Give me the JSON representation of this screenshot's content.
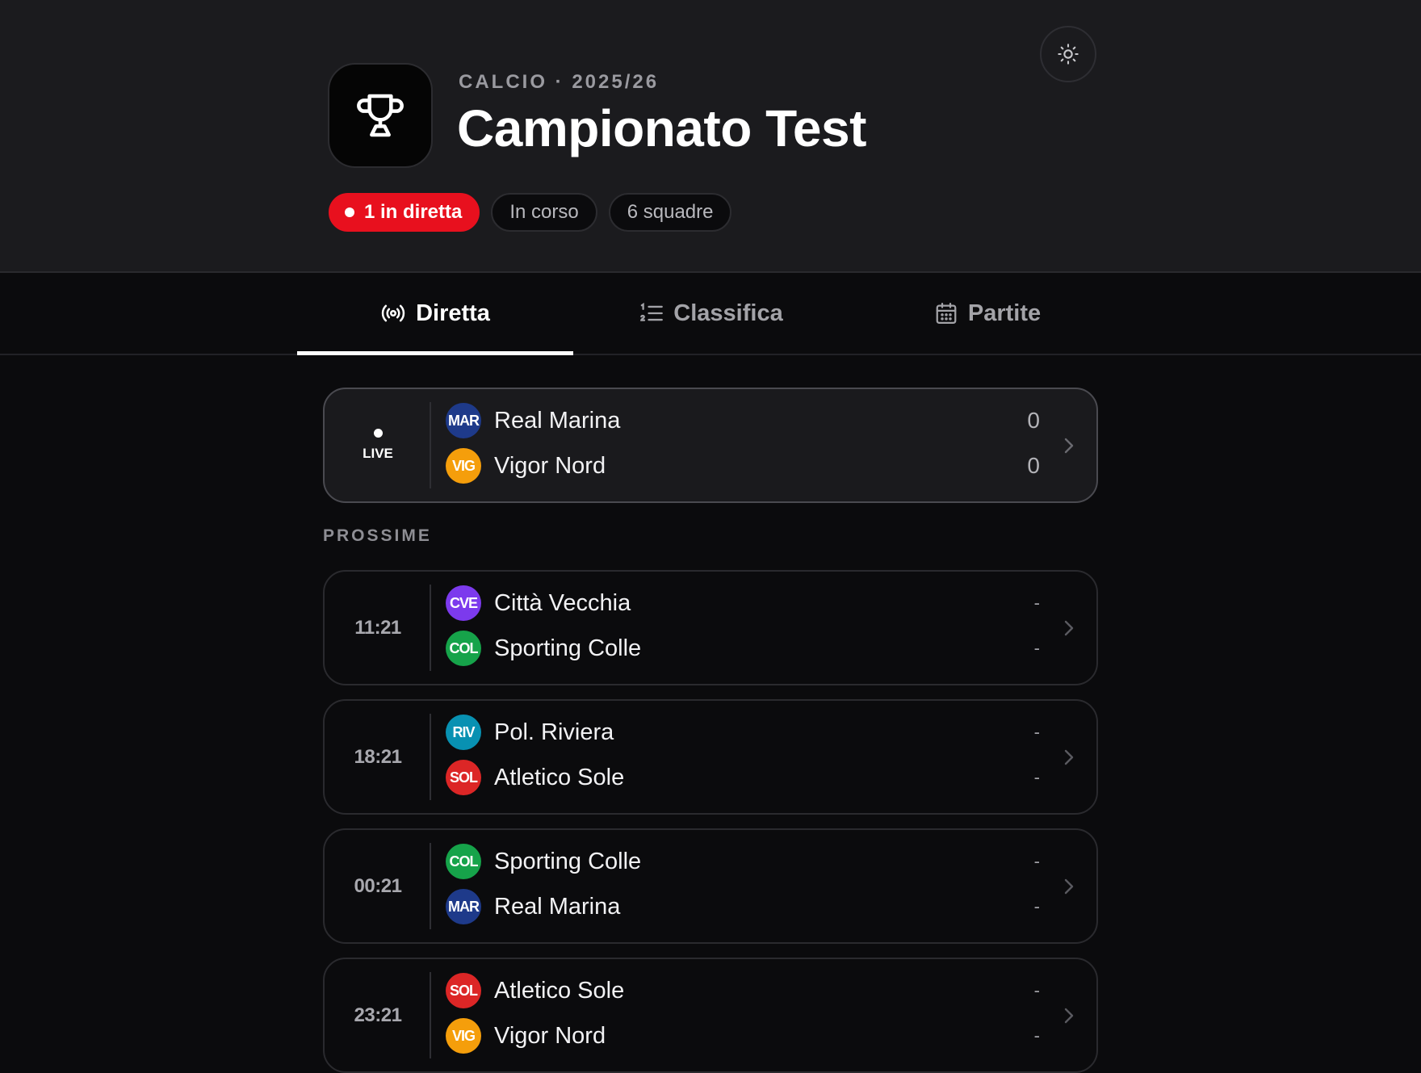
{
  "header": {
    "kicker": "CALCIO · 2025/26",
    "title": "Campionato Test",
    "chips": {
      "live": "1 in diretta",
      "status": "In corso",
      "teams": "6 squadre"
    }
  },
  "tabs": [
    {
      "label": "Diretta",
      "icon": "broadcast-icon",
      "active": true
    },
    {
      "label": "Classifica",
      "icon": "ranked-list-icon",
      "active": false
    },
    {
      "label": "Partite",
      "icon": "calendar-icon",
      "active": false
    }
  ],
  "live_match": {
    "label": "LIVE",
    "home": {
      "abbr": "MAR",
      "name": "Real Marina",
      "score": "0",
      "color": "#1e3a8a"
    },
    "away": {
      "abbr": "VIG",
      "name": "Vigor Nord",
      "score": "0",
      "color": "#f59e0b"
    }
  },
  "upcoming": {
    "label": "PROSSIME",
    "matches": [
      {
        "time": "11:21",
        "home": {
          "abbr": "CVE",
          "name": "Città Vecchia",
          "score": "-",
          "color": "#7c3aed"
        },
        "away": {
          "abbr": "COL",
          "name": "Sporting Colle",
          "score": "-",
          "color": "#16a34a"
        }
      },
      {
        "time": "18:21",
        "home": {
          "abbr": "RIV",
          "name": "Pol. Riviera",
          "score": "-",
          "color": "#0891b2"
        },
        "away": {
          "abbr": "SOL",
          "name": "Atletico Sole",
          "score": "-",
          "color": "#dc2626"
        }
      },
      {
        "time": "00:21",
        "home": {
          "abbr": "COL",
          "name": "Sporting Colle",
          "score": "-",
          "color": "#16a34a"
        },
        "away": {
          "abbr": "MAR",
          "name": "Real Marina",
          "score": "-",
          "color": "#1e3a8a"
        }
      },
      {
        "time": "23:21",
        "home": {
          "abbr": "SOL",
          "name": "Atletico Sole",
          "score": "-",
          "color": "#dc2626"
        },
        "away": {
          "abbr": "VIG",
          "name": "Vigor Nord",
          "score": "-",
          "color": "#f59e0b"
        }
      }
    ]
  },
  "colors": {
    "live_red": "#e8101e",
    "background": "#0b0b0d",
    "header_bg": "#1b1b1e"
  }
}
